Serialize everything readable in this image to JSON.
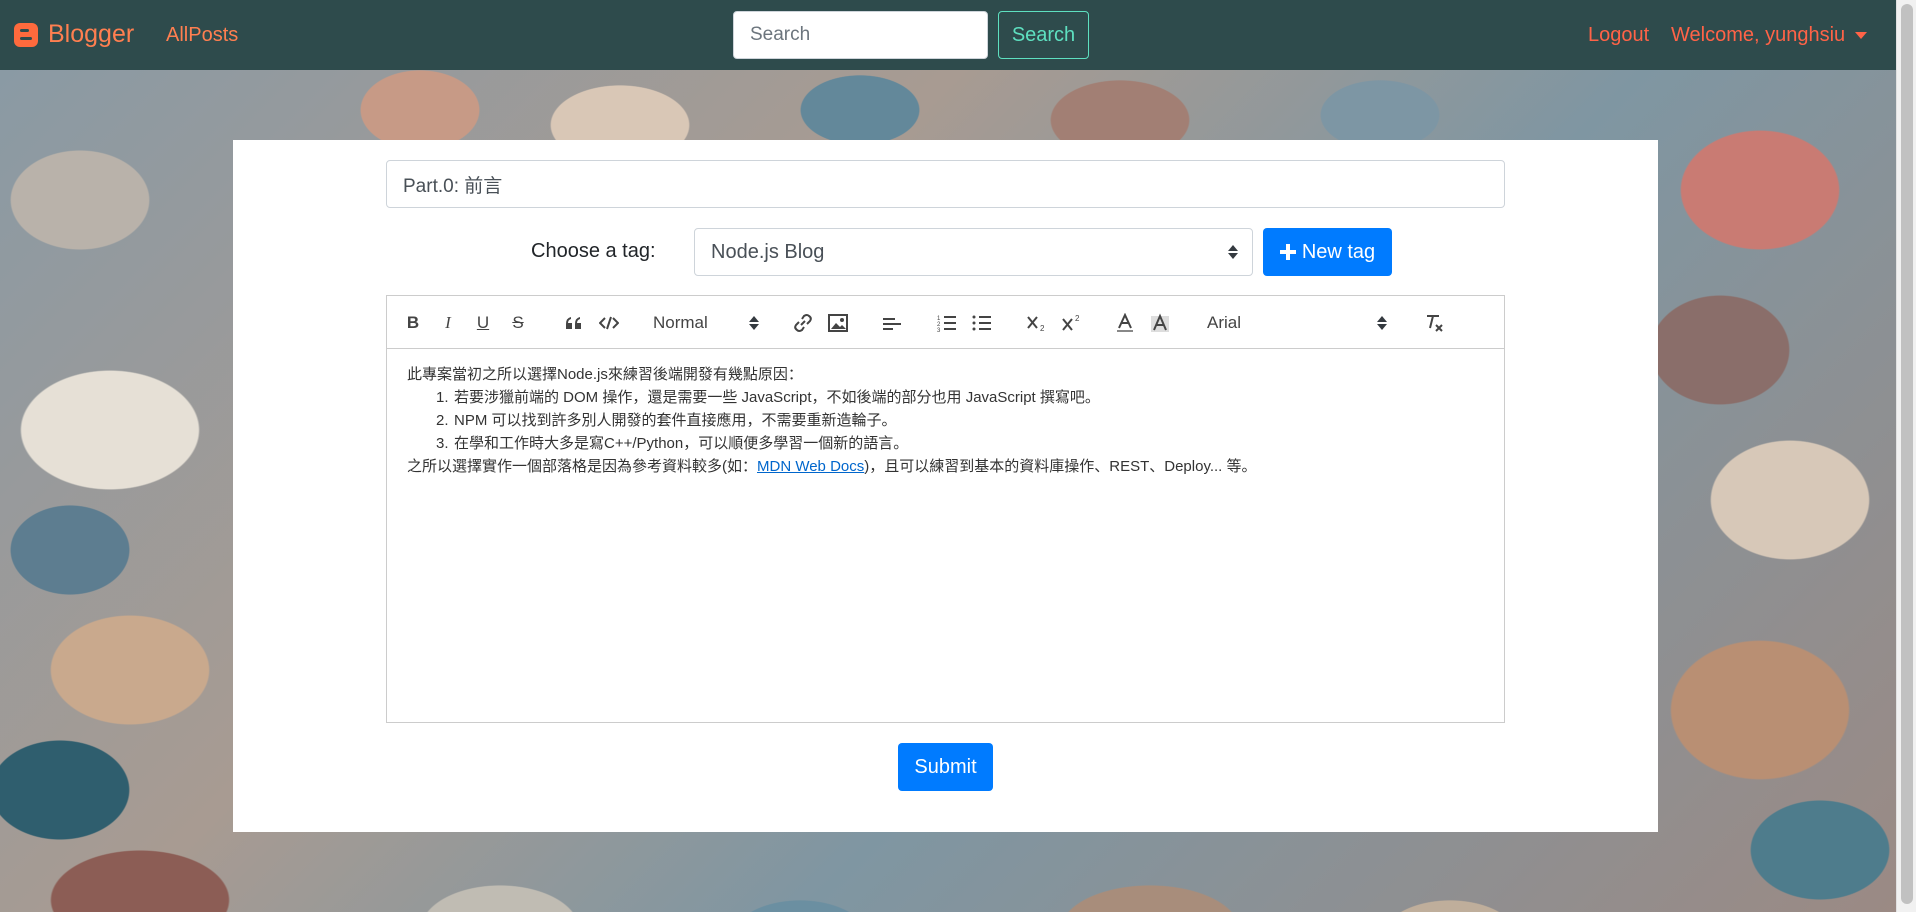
{
  "navbar": {
    "brand": "Blogger",
    "all_posts": "AllPosts",
    "search_placeholder": "Search",
    "search_button": "Search",
    "logout": "Logout",
    "welcome": "Welcome, yunghsiu",
    "bg_color": "#2e4b4c",
    "link_color": "#ff6347"
  },
  "form": {
    "title_value": "Part.0: 前言",
    "tag_label": "Choose a tag:",
    "tag_selected": "Node.js Blog",
    "new_tag_button": "New tag",
    "submit_button": "Submit",
    "accent_color": "#007bff"
  },
  "toolbar": {
    "bold": "B",
    "italic": "I",
    "underline": "U",
    "strike": "S",
    "header_select": "Normal",
    "font_select": "Arial"
  },
  "editor": {
    "intro": "此專案當初之所以選擇Node.js來練習後端開發有幾點原因：",
    "reasons": [
      {
        "num": "1.",
        "text": "若要涉獵前端的 DOM 操作，還是需要一些 JavaScript，不如後端的部分也用 JavaScript 撰寫吧。"
      },
      {
        "num": "2.",
        "text": "NPM 可以找到許多別人開發的套件直接應用，不需要重新造輪子。"
      },
      {
        "num": "3.",
        "text": "在學和工作時大多是寫C++/Python，可以順便多學習一個新的語言。"
      }
    ],
    "outro_prefix": "之所以選擇實作一個部落格是因為參考資料較多(如：",
    "outro_link": "MDN Web Docs",
    "outro_suffix": ")，且可以練習到基本的資料庫操作、REST、Deploy... 等。"
  }
}
